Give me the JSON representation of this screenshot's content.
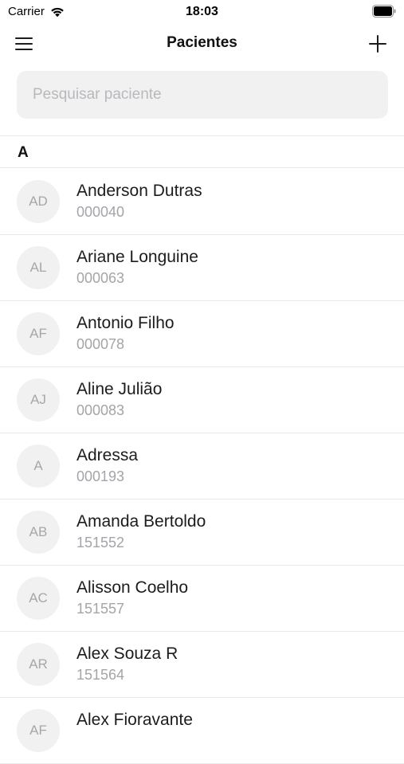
{
  "status_bar": {
    "carrier": "Carrier",
    "time": "18:03",
    "wifi_icon": "wifi-icon",
    "battery_icon": "battery-icon"
  },
  "nav": {
    "title": "Pacientes",
    "menu_icon": "hamburger-menu-icon",
    "add_icon": "plus-icon"
  },
  "search": {
    "placeholder": "Pesquisar paciente",
    "value": ""
  },
  "section": {
    "letter": "A"
  },
  "patients": [
    {
      "initials": "AD",
      "name": "Anderson Dutras",
      "code": "000040"
    },
    {
      "initials": "AL",
      "name": "Ariane Longuine",
      "code": "000063"
    },
    {
      "initials": "AF",
      "name": "Antonio Filho",
      "code": "000078"
    },
    {
      "initials": "AJ",
      "name": "Aline Julião",
      "code": "000083"
    },
    {
      "initials": "A",
      "name": "Adressa",
      "code": "000193"
    },
    {
      "initials": "AB",
      "name": "Amanda Bertoldo",
      "code": "151552"
    },
    {
      "initials": "AC",
      "name": "Alisson Coelho",
      "code": "151557"
    },
    {
      "initials": "AR",
      "name": "Alex Souza R",
      "code": "151564"
    },
    {
      "initials": "AF",
      "name": "Alex Fioravante",
      "code": ""
    }
  ],
  "colors": {
    "background": "#ffffff",
    "search_bg": "#f1f1f2",
    "avatar_bg": "#f1f1f2",
    "secondary_text": "#a4a4a9",
    "separator": "#e9e9ec"
  }
}
